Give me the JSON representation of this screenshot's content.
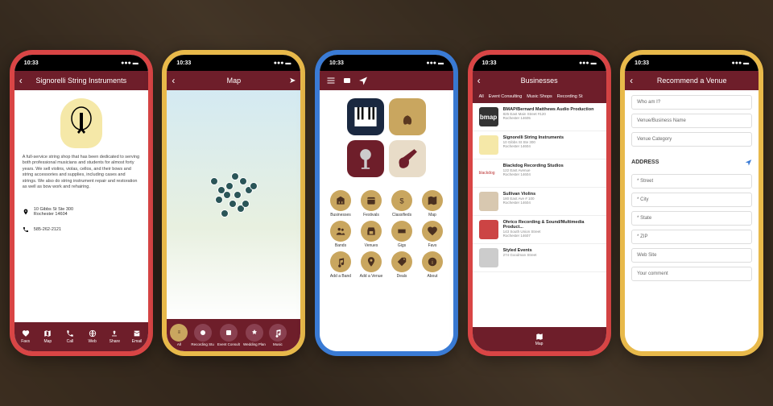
{
  "status": {
    "time": "10:33"
  },
  "p1": {
    "title": "Signorelli String Instruments",
    "desc": "A full-service string shop that has been dedicated to serving both professional musicians and students for almost forty years. We sell violins, violas, cellos, and their bows and string accessories and supplies, including cases and strings. We also do string instrument repair and restoration as well as bow work and rehairing.",
    "addr": "10 Gibbs St Ste 300\nRochester 14604",
    "phone": "585-262-2121",
    "tabs": [
      "Favs",
      "Map",
      "Call",
      "Web",
      "Share",
      "Email"
    ]
  },
  "p2": {
    "title": "Map",
    "cats": [
      "All",
      "Recording Stu",
      "Event Consult",
      "Wedding Plan",
      "Music"
    ]
  },
  "p3": {
    "grid": [
      "Businesses",
      "Festivals",
      "Classifieds",
      "Map",
      "Bands",
      "Venues",
      "Gigs",
      "Favs",
      "Add a Band",
      "Add a Venue",
      "Deals",
      "About"
    ]
  },
  "p4": {
    "title": "Businesses",
    "filters": [
      "All",
      "Event Consulting",
      "Music Shops",
      "Recording St"
    ],
    "items": [
      {
        "name": "BMAP/Bernard Matthews Audio Production",
        "sub": "825 East Main Street #120\nRochester 14605"
      },
      {
        "name": "Signorelli String Instruments",
        "sub": "10 Gibbs St Ste 300\nRochester 14604"
      },
      {
        "name": "Blackdog Recording Studios",
        "sub": "122 East Avenue\nRochester 14604"
      },
      {
        "name": "Sullivan Violins",
        "sub": "180 East Ave # 100\nRochester 14604"
      },
      {
        "name": "Ohrico Recording & Sound/Multimedia Product...",
        "sub": "143 South Union Street\nRochester 14607"
      },
      {
        "name": "Styled Events",
        "sub": "274 Goodman Street"
      }
    ],
    "footer": "Map"
  },
  "p5": {
    "title": "Recommend a Venue",
    "who": "Who am I?",
    "name": "Venue/Business Name",
    "cat": "Venue Category",
    "section": "ADDRESS",
    "street": "* Street",
    "city": "* City",
    "state": "* State",
    "zip": "* ZIP",
    "web": "Web Site",
    "comment": "Your comment"
  }
}
